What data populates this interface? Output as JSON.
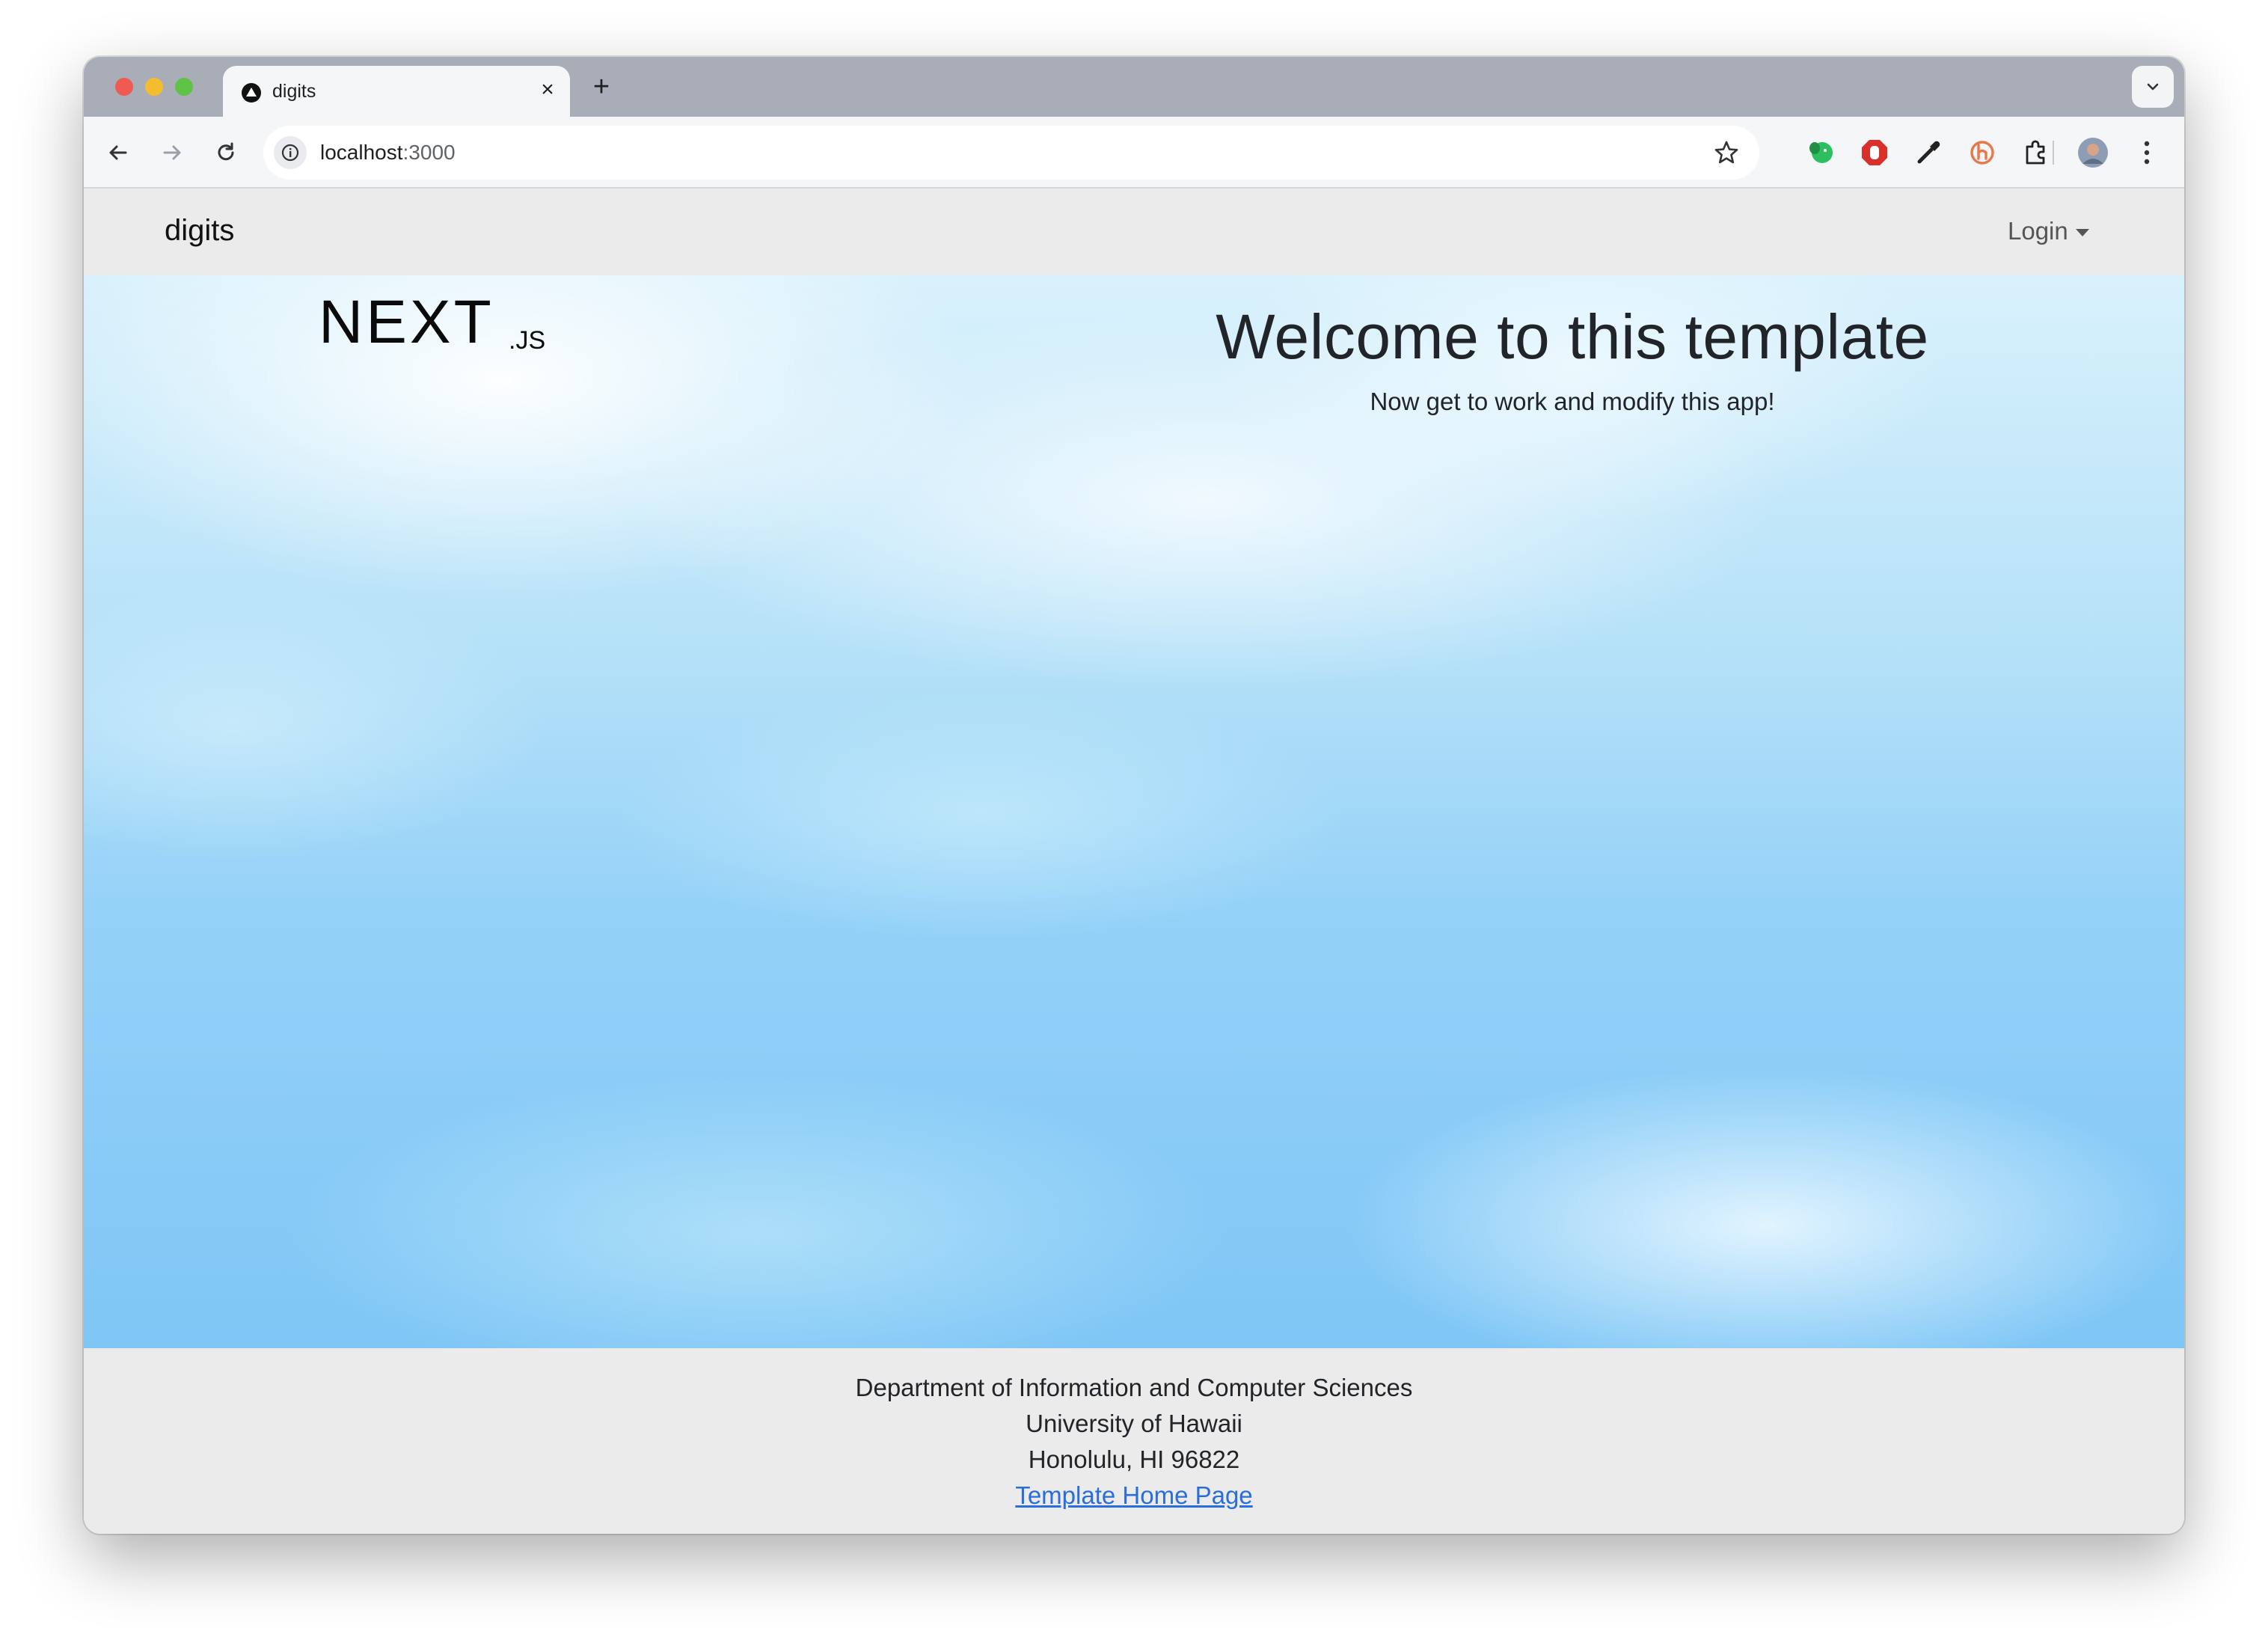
{
  "browser": {
    "tab_title": "digits",
    "tab_close": "×",
    "new_tab": "+",
    "url_host": "localhost",
    "url_port": ":3000",
    "icons": [
      "back-icon",
      "forward-icon",
      "reload-icon",
      "site-info-icon",
      "bookmark-star-icon",
      "extension-icons",
      "profile-avatar",
      "more-menu-icon"
    ]
  },
  "navbar": {
    "brand": "digits",
    "login_label": "Login"
  },
  "hero": {
    "logo_text": "NEXT",
    "logo_suffix": ".JS",
    "title": "Welcome to this template",
    "subtitle": "Now get to work and modify this app!"
  },
  "footer": {
    "line1": "Department of Information and Computer Sciences",
    "line2": "University of Hawaii",
    "line3": "Honolulu, HI 96822",
    "link_text": "Template Home Page"
  },
  "colors": {
    "link": "#2a6edb",
    "navbar_bg": "#ebebeb",
    "sky": "#7fc6f6"
  }
}
